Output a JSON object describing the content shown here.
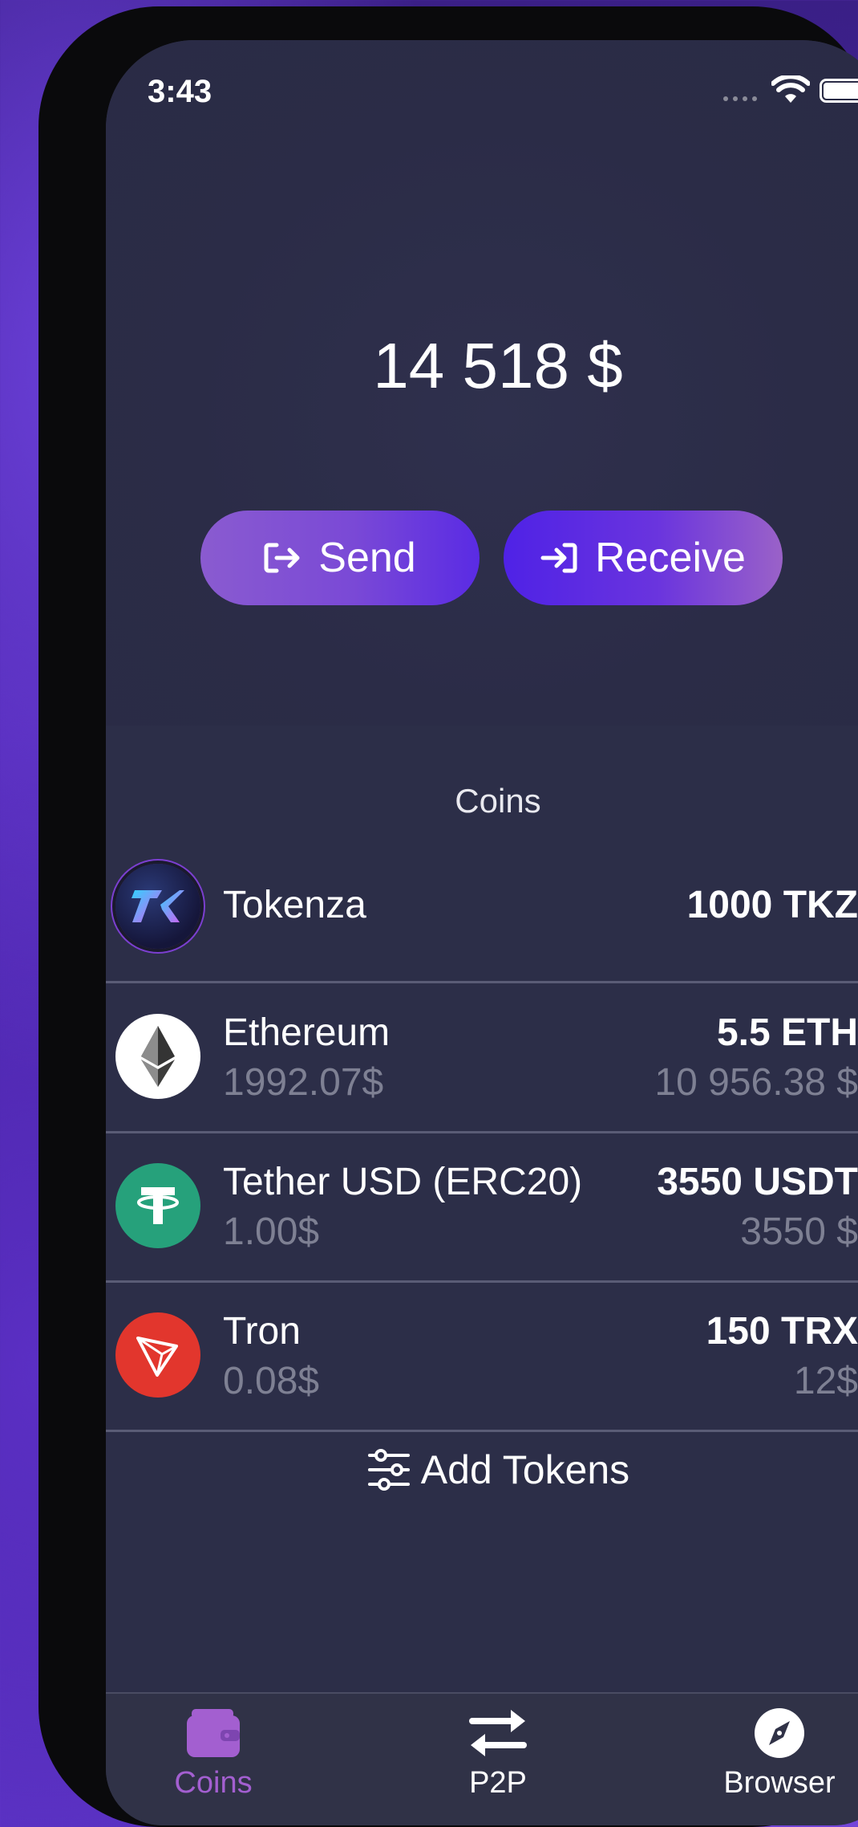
{
  "status_bar": {
    "time": "3:43"
  },
  "wallet": {
    "balance": "14 518 $"
  },
  "actions": {
    "send_label": "Send",
    "receive_label": "Receive"
  },
  "coins": {
    "title": "Coins",
    "items": [
      {
        "name": "Tokenza",
        "price": "",
        "amount": "1000 TKZ",
        "value": "",
        "icon": "tokenza-logo-icon"
      },
      {
        "name": "Ethereum",
        "price": "1992.07$",
        "amount": "5.5 ETH",
        "value": "10 956.38 $",
        "icon": "ethereum-logo-icon"
      },
      {
        "name": "Tether USD (ERC20)",
        "price": "1.00$",
        "amount": "3550 USDT",
        "value": "3550 $",
        "icon": "tether-logo-icon"
      },
      {
        "name": "Tron",
        "price": "0.08$",
        "amount": "150 TRX",
        "value": "12$",
        "icon": "tron-logo-icon"
      }
    ],
    "add_tokens_label": "Add Tokens"
  },
  "tabs": [
    {
      "label": "Coins",
      "icon": "wallet-icon",
      "active": true
    },
    {
      "label": "P2P",
      "icon": "swap-arrows-icon",
      "active": false
    },
    {
      "label": "Browser",
      "icon": "compass-icon",
      "active": false
    }
  ],
  "colors": {
    "accent": "#a35fd0",
    "tether": "#26a17b",
    "tron": "#e2362d",
    "muted_text": "#7e8093"
  }
}
